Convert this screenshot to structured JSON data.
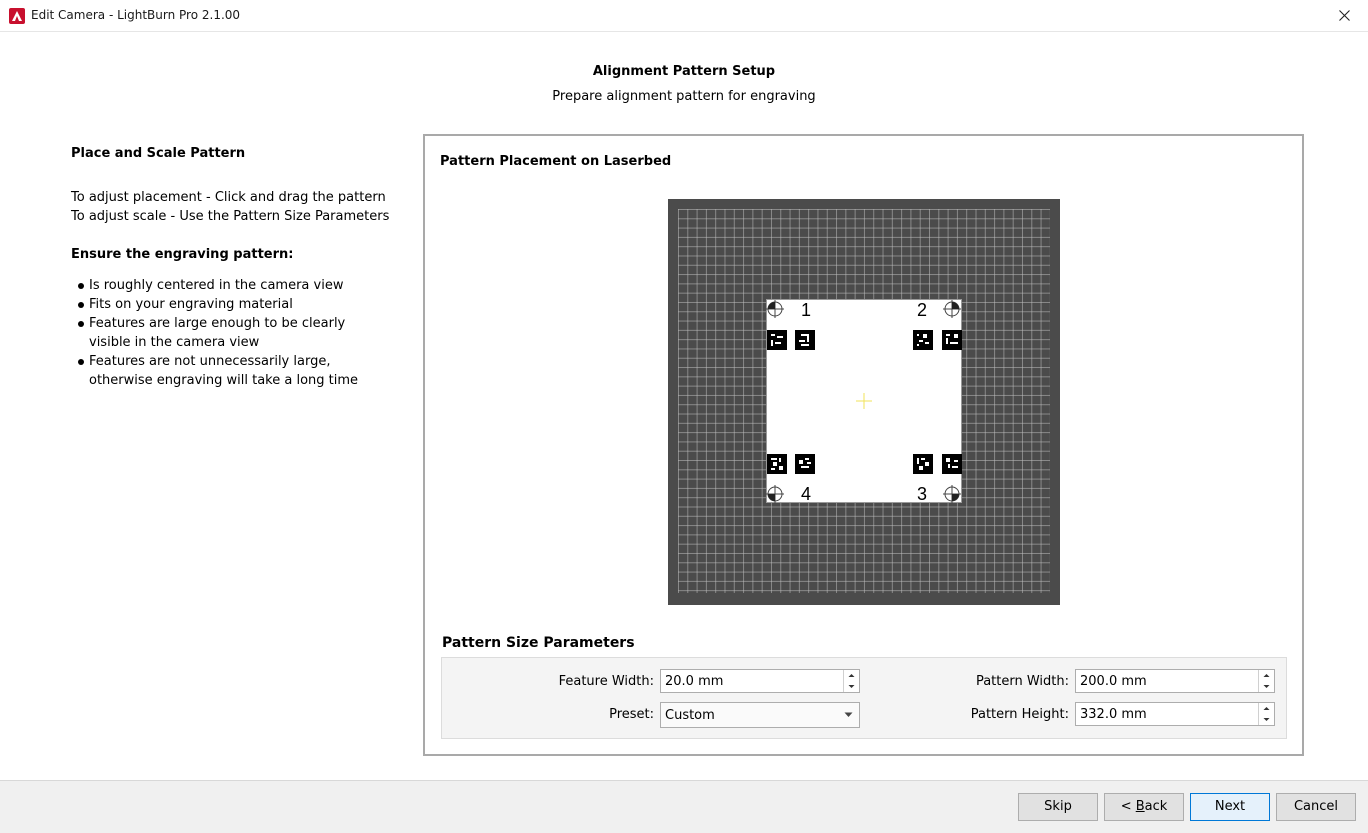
{
  "window": {
    "title": "Edit Camera - LightBurn Pro 2.1.00"
  },
  "header": {
    "title": "Alignment Pattern Setup",
    "subtitle": "Prepare alignment pattern for engraving"
  },
  "instructions": {
    "heading": "Place and Scale Pattern",
    "lines": [
      "To adjust placement - Click and drag the pattern",
      "To adjust scale - Use the Pattern Size Parameters"
    ],
    "subheading": "Ensure the engraving pattern:",
    "bullets": [
      "Is roughly centered in the camera view",
      "Fits on your engraving material",
      "Features are large enough to be clearly visible in the camera view",
      "Features are not unnecessarily large, otherwise engraving will take a long time"
    ]
  },
  "placement": {
    "title": "Pattern Placement on Laserbed",
    "corners": [
      "1",
      "2",
      "3",
      "4"
    ]
  },
  "parameters": {
    "title": "Pattern Size Parameters",
    "feature_width": {
      "label": "Feature Width:",
      "value": "20.0 mm"
    },
    "preset": {
      "label": "Preset:",
      "value": "Custom"
    },
    "pattern_width": {
      "label": "Pattern Width:",
      "value": "200.0 mm"
    },
    "pattern_height": {
      "label": "Pattern Height:",
      "value": "332.0 mm"
    }
  },
  "buttons": {
    "skip": "Skip",
    "back_prefix": "< ",
    "back_mnemonic": "B",
    "back_rest": "ack",
    "next": "Next",
    "cancel": "Cancel"
  },
  "colors": {
    "laserbed": "#4b4b4b",
    "accent": "#0078d7",
    "app_icon": "#c8102e",
    "crosshair": "#f2e35a"
  }
}
